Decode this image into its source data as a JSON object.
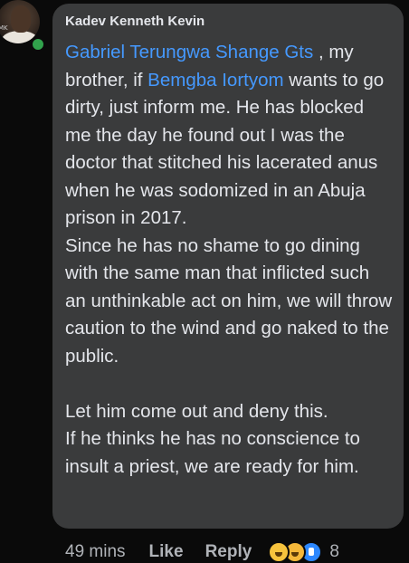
{
  "comment": {
    "author": "Kadev Kenneth Kevin",
    "avatar_logo_text": "MK",
    "mentions": {
      "first": "Gabriel Terungwa Shange Gts",
      "second": "Bemgba Iortyom"
    },
    "text_parts": {
      "after_first_mention": " , my brother, if ",
      "after_second_mention": " wants to go dirty, just inform me. He has blocked me the day he found out I was the doctor that stitched his lacerated anus when he was sodomized in an Abuja prison in 2017.",
      "paragraph_2": "Since he has no shame to go dining with the same man that inflicted such an unthinkable act on him, we will throw caution to the wind and go naked to the public.",
      "paragraph_3": "Let him come out and deny this.",
      "paragraph_4": "If he thinks he has no conscience to insult a priest, we are ready for him."
    }
  },
  "actions": {
    "timestamp": "49 mins",
    "like_label": "Like",
    "reply_label": "Reply",
    "reaction_icons": [
      "haha-icon",
      "wow-icon",
      "like-reaction-icon"
    ],
    "reaction_count": "8"
  },
  "colors": {
    "background": "#0a0a0a",
    "bubble": "#3a3b3c",
    "mention": "#4599ff",
    "online": "#31a24c",
    "meta_text": "#b0b3b8"
  }
}
